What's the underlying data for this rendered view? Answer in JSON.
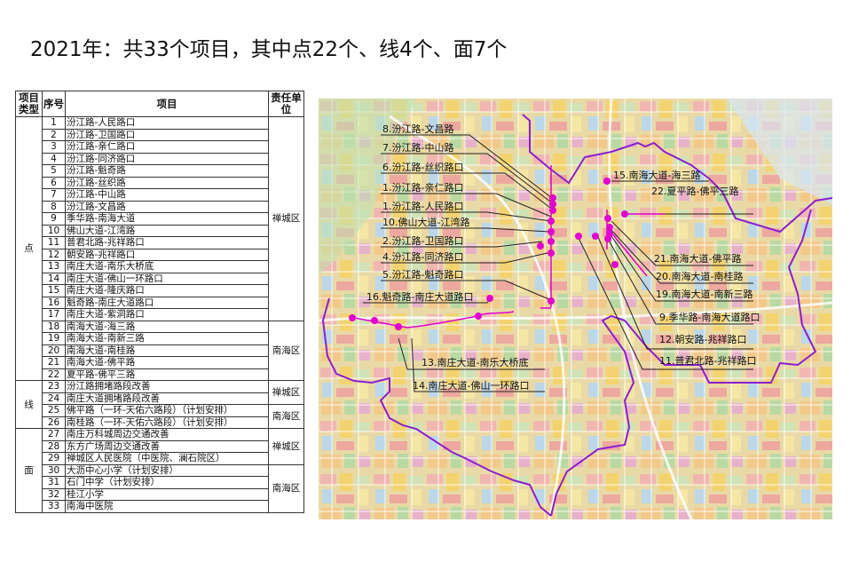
{
  "title": "2021年：共33个项目，其中点22个、线4个、面7个",
  "table": {
    "headers": {
      "type": "项目类型",
      "no": "序号",
      "project": "项目",
      "dept": "责任单位"
    },
    "groups": [
      {
        "type": "点",
        "districts": [
          {
            "name": "禅城区",
            "rows": 17
          },
          {
            "name": "南海区",
            "rows": 5
          }
        ]
      },
      {
        "type": "线",
        "districts": [
          {
            "name": "禅城区",
            "rows": 2
          },
          {
            "name": "南海区",
            "rows": 2
          }
        ]
      },
      {
        "type": "面",
        "districts": [
          {
            "name": "禅城区",
            "rows": 3
          },
          {
            "name": "南海区",
            "rows": 4
          }
        ]
      }
    ],
    "rows": [
      {
        "no": "1",
        "name": "汾江路-人民路口"
      },
      {
        "no": "2",
        "name": "汾江路-卫国路口"
      },
      {
        "no": "3",
        "name": "汾江路-亲仁路口"
      },
      {
        "no": "4",
        "name": "汾江路-同济路口"
      },
      {
        "no": "5",
        "name": "汾江路-魁奇路"
      },
      {
        "no": "6",
        "name": "汾江路-丝织路"
      },
      {
        "no": "7",
        "name": "汾江路-中山路"
      },
      {
        "no": "8",
        "name": "汾江路-文昌路"
      },
      {
        "no": "9",
        "name": "季华路-南海大道"
      },
      {
        "no": "10",
        "name": "佛山大道-江湾路"
      },
      {
        "no": "11",
        "name": "普君北路-兆祥路口"
      },
      {
        "no": "12",
        "name": "朝安路-兆祥路口"
      },
      {
        "no": "13",
        "name": "南庄大道-南乐大桥底"
      },
      {
        "no": "14",
        "name": "南庄大道-佛山一环路口"
      },
      {
        "no": "15",
        "name": "南庄大道-隆庆路口"
      },
      {
        "no": "16",
        "name": "魁奇路-南庄大道路口"
      },
      {
        "no": "17",
        "name": "南庄大道-紫洞路口"
      },
      {
        "no": "18",
        "name": "南海大道-海三路"
      },
      {
        "no": "19",
        "name": "南海大道-南新三路"
      },
      {
        "no": "20",
        "name": "南海大道-南桂路"
      },
      {
        "no": "21",
        "name": "南海大道-佛平路"
      },
      {
        "no": "22",
        "name": "夏平路-佛平三路"
      },
      {
        "no": "23",
        "name": "汾江路拥堵路段改善"
      },
      {
        "no": "24",
        "name": "南庄大道拥堵路段改善"
      },
      {
        "no": "25",
        "name": "佛平路（一环-天佑六路段）（计划安排）"
      },
      {
        "no": "26",
        "name": "南桂路（一环-天佑六路段）（计划安排）"
      },
      {
        "no": "27",
        "name": "南庄万科城周边交通改善"
      },
      {
        "no": "28",
        "name": "东方广场周边交通改善"
      },
      {
        "no": "29",
        "name": "禅城区人民医院（中医院、澜石院区）"
      },
      {
        "no": "30",
        "name": "大沥中心小学（计划安排）"
      },
      {
        "no": "31",
        "name": "石门中学（计划安排）"
      },
      {
        "no": "32",
        "name": "桂江小学"
      },
      {
        "no": "33",
        "name": "南海中医院"
      }
    ]
  },
  "map": {
    "marker_color": "#e000d0",
    "boundary_color": "#8a1fd0",
    "labels": [
      "8.汾江路-文昌路",
      "7.汾江路-中山路",
      "6.汾江路-丝织路口",
      "1.汾江路-亲仁路口",
      "1.汾江路-人民路口",
      "10.佛山大道-江湾路",
      "2.汾江路-卫国路口",
      "4.汾江路-同济路口",
      "5.汾江路-魁奇路口",
      "16.魁奇路-南庄大道路口",
      "15.南海大道-海三路",
      "22.夏平路-佛平三路",
      "21.南海大道-佛平路",
      "20.南海大道-南桂路",
      "19.南海大道-南新三路",
      "9.季华路-南海大道路口",
      "12.朝安路-兆祥路口",
      "11.普君北路-兆祥路口",
      "13.南庄大道-南乐大桥底",
      "14.南庄大道-佛山一环路口"
    ]
  }
}
